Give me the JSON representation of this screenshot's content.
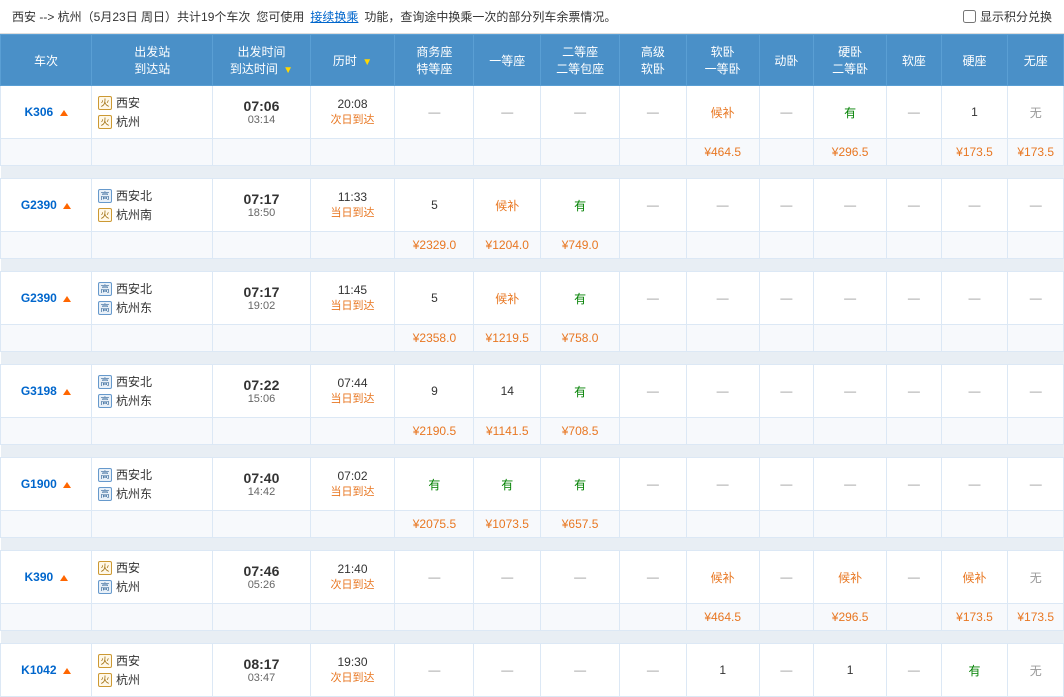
{
  "topBar": {
    "routeText": "西安 --> 杭州（5月23日 周日）共计19个车次",
    "tipPrefix": "您可使用",
    "tipLink": "接续换乘",
    "tipSuffix": "功能，查询途中换乘一次的部分列车余票情况。",
    "checkboxLabel": "显示积分兑换"
  },
  "header": {
    "cols": [
      {
        "key": "train",
        "label": "车次"
      },
      {
        "key": "station",
        "label": "出发站\n到达站"
      },
      {
        "key": "depart",
        "label": "出发时间\n到达时间",
        "sortable": true
      },
      {
        "key": "duration",
        "label": "历时",
        "sortable": true
      },
      {
        "key": "biz",
        "label": "商务座\n特等座"
      },
      {
        "key": "first",
        "label": "一等座"
      },
      {
        "key": "second",
        "label": "二等座\n二等包座"
      },
      {
        "key": "adv_soft",
        "label": "高级\n软卧"
      },
      {
        "key": "soft_first",
        "label": "软卧\n一等卧"
      },
      {
        "key": "dyn",
        "label": "动卧"
      },
      {
        "key": "hard_second",
        "label": "硬卧\n二等卧"
      },
      {
        "key": "soft",
        "label": "软座"
      },
      {
        "key": "hard",
        "label": "硬座"
      },
      {
        "key": "no",
        "label": "无座"
      }
    ]
  },
  "trains": [
    {
      "id": "K306",
      "type": "K",
      "fromStation": "西安",
      "fromIcon": "train",
      "toStation": "杭州",
      "toIcon": "train",
      "departTime": "07:06",
      "arriveTime": "03:14",
      "duration": "20:08",
      "arriveDay": "次日到达",
      "biz": "—",
      "first": "—",
      "second": "—",
      "adv_soft": "—",
      "soft_first": "候补",
      "dyn": "—",
      "hard_second": "有",
      "soft": "—",
      "hard": "1",
      "no": "无",
      "prices": {
        "soft_first": "¥464.5",
        "hard_second": "¥296.5",
        "hard": "¥173.5",
        "no": "¥173.5"
      }
    },
    {
      "id": "G2390",
      "type": "G",
      "fromStation": "西安北",
      "fromIcon": "bullet",
      "toStation": "杭州南",
      "toIcon": "train",
      "departTime": "07:17",
      "arriveTime": "18:50",
      "duration": "11:33",
      "arriveDay": "当日到达",
      "biz": "5",
      "first": "候补",
      "second": "有",
      "adv_soft": "—",
      "soft_first": "—",
      "dyn": "—",
      "hard_second": "—",
      "soft": "—",
      "hard": "—",
      "no": "—",
      "prices": {
        "biz": "¥2329.0",
        "first": "¥1204.0",
        "second": "¥749.0"
      }
    },
    {
      "id": "G2390b",
      "displayId": "G2390",
      "type": "G",
      "fromStation": "西安北",
      "fromIcon": "bullet",
      "toStation": "杭州东",
      "toIcon": "bullet",
      "departTime": "07:17",
      "arriveTime": "19:02",
      "duration": "11:45",
      "arriveDay": "当日到达",
      "biz": "5",
      "first": "候补",
      "second": "有",
      "adv_soft": "—",
      "soft_first": "—",
      "dyn": "—",
      "hard_second": "—",
      "soft": "—",
      "hard": "—",
      "no": "—",
      "prices": {
        "biz": "¥2358.0",
        "first": "¥1219.5",
        "second": "¥758.0"
      }
    },
    {
      "id": "G3198",
      "type": "G",
      "fromStation": "西安北",
      "fromIcon": "bullet",
      "toStation": "杭州东",
      "toIcon": "bullet",
      "departTime": "07:22",
      "arriveTime": "15:06",
      "duration": "07:44",
      "arriveDay": "当日到达",
      "biz": "9",
      "first": "14",
      "second": "有",
      "adv_soft": "—",
      "soft_first": "—",
      "dyn": "—",
      "hard_second": "—",
      "soft": "—",
      "hard": "—",
      "no": "—",
      "prices": {
        "biz": "¥2190.5",
        "first": "¥1141.5",
        "second": "¥708.5"
      }
    },
    {
      "id": "G1900",
      "type": "G",
      "fromStation": "西安北",
      "fromIcon": "bullet",
      "toStation": "杭州东",
      "toIcon": "bullet",
      "departTime": "07:40",
      "arriveTime": "14:42",
      "duration": "07:02",
      "arriveDay": "当日到达",
      "biz": "有",
      "first": "有",
      "second": "有",
      "adv_soft": "—",
      "soft_first": "—",
      "dyn": "—",
      "hard_second": "—",
      "soft": "—",
      "hard": "—",
      "no": "—",
      "prices": {
        "biz": "¥2075.5",
        "first": "¥1073.5",
        "second": "¥657.5"
      }
    },
    {
      "id": "K390",
      "type": "K",
      "fromStation": "西安",
      "fromIcon": "train",
      "toStation": "杭州",
      "toIcon": "bullet",
      "departTime": "07:46",
      "arriveTime": "05:26",
      "duration": "21:40",
      "arriveDay": "次日到达",
      "biz": "—",
      "first": "—",
      "second": "—",
      "adv_soft": "—",
      "soft_first": "候补",
      "dyn": "—",
      "hard_second": "候补",
      "soft": "—",
      "hard": "候补",
      "no": "无",
      "prices": {
        "soft_first": "¥464.5",
        "hard_second": "¥296.5",
        "hard": "¥173.5",
        "no": "¥173.5"
      }
    },
    {
      "id": "K1042",
      "type": "K",
      "fromStation": "西安",
      "fromIcon": "train",
      "toStation": "杭州",
      "toIcon": "train",
      "departTime": "08:17",
      "arriveTime": "03:47",
      "duration": "19:30",
      "arriveDay": "次日到达",
      "biz": "—",
      "first": "—",
      "second": "—",
      "adv_soft": "—",
      "soft_first": "1",
      "dyn": "—",
      "hard_second": "1",
      "soft": "—",
      "hard": "有",
      "no": "无",
      "prices": {}
    }
  ],
  "icons": {
    "sort_asc": "▲",
    "sort_desc": "▼"
  }
}
